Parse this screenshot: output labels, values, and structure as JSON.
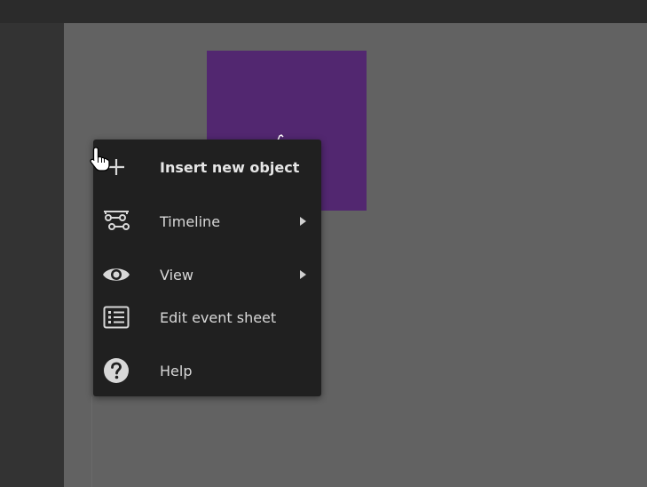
{
  "editor": {
    "object_color": "#522770",
    "canvas_color": "#626262"
  },
  "context_menu": {
    "items": [
      {
        "label": "Insert new object",
        "icon": "plus-icon",
        "has_submenu": false
      },
      {
        "label": "Timeline",
        "icon": "timeline-icon",
        "has_submenu": true
      },
      {
        "label": "View",
        "icon": "eye-icon",
        "has_submenu": true
      },
      {
        "label": "Edit event sheet",
        "icon": "event-sheet-icon",
        "has_submenu": false
      },
      {
        "label": "Help",
        "icon": "help-icon",
        "has_submenu": false
      }
    ]
  }
}
